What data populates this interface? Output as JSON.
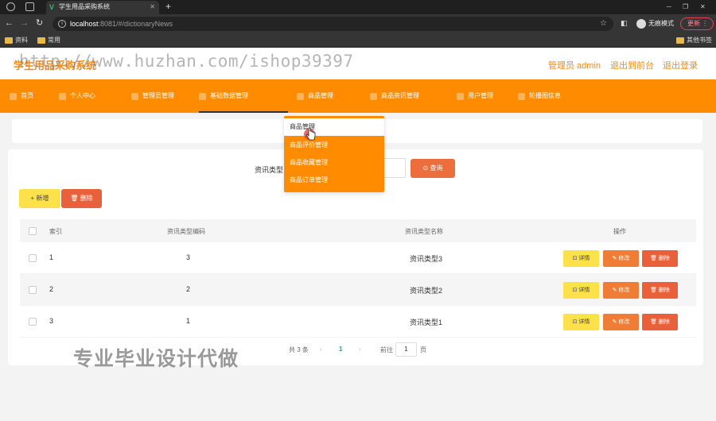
{
  "browser": {
    "tab_title": "学生用品采购系统",
    "tab_icon": "V",
    "url_host": "localhost",
    "url_path": ":8081/#/dictionaryNews",
    "incognito_label": "无痕模式",
    "update_label": "更新",
    "bookmarks": [
      "资料",
      "常用",
      "其他书签"
    ]
  },
  "header": {
    "title": "学生用品采购系统",
    "admin_label": "管理员 admin",
    "back_front_label": "退出到前台",
    "logout_label": "退出登录"
  },
  "nav": {
    "items": [
      "首页",
      "个人中心",
      "管理员管理",
      "基础数据管理",
      "商品管理",
      "商品资讯管理",
      "用户管理",
      "轮播图信息"
    ],
    "active_index": 3
  },
  "dropdown": {
    "items": [
      "商品管理",
      "商品评价管理",
      "商品收藏管理",
      "商品订单管理"
    ],
    "hover_index": 0
  },
  "search": {
    "label": "资讯类型",
    "query_label": "查询"
  },
  "actions": {
    "add_label": "新增",
    "delete_label": "删除"
  },
  "table": {
    "headers": [
      "索引",
      "资讯类型编码",
      "资讯类型名称",
      "操作"
    ],
    "rows": [
      {
        "index": "1",
        "code": "3",
        "name": "资讯类型3"
      },
      {
        "index": "2",
        "code": "2",
        "name": "资讯类型2"
      },
      {
        "index": "3",
        "code": "1",
        "name": "资讯类型1"
      }
    ],
    "row_actions": {
      "detail": "详情",
      "edit": "修改",
      "delete": "删除"
    }
  },
  "pagination": {
    "total_label": "共 3 条",
    "current_page": "1",
    "goto_label": "前往",
    "goto_value": "1",
    "page_unit": "页"
  },
  "watermarks": {
    "url": "http://www.huzhan.com/ishop39397",
    "bottom": "专业毕业设计代做"
  },
  "colors": {
    "accent": "#ff8c00",
    "title": "#f08a19",
    "yellow_button": "#fde14a",
    "red_button": "#e8613a"
  }
}
